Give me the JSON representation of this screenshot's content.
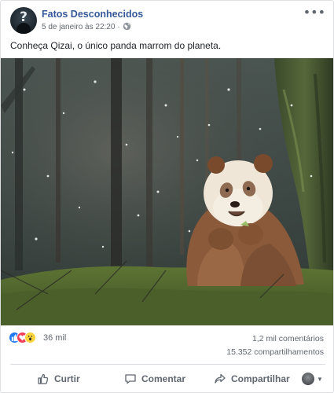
{
  "post": {
    "page_name": "Fatos Desconhecidos",
    "timestamp": "5 de janeiro às 22:20",
    "separator": "·",
    "privacy_icon": "globe-icon",
    "menu_icon": "more-options-icon",
    "avatar_glyph": "?",
    "text": "Conheça Qizai, o único panda marrom do planeta."
  },
  "photo": {
    "subject": "brown-panda",
    "colors": {
      "forest_dark": "#3a4340",
      "fur_brown": "#8a5a3a",
      "fur_cream": "#efe6d8",
      "grass": "#6f8a3a"
    }
  },
  "engagement": {
    "reaction_icons": [
      "like-react-icon",
      "love-react-icon",
      "wow-react-icon"
    ],
    "reaction_count": "36 mil",
    "comments": "1,2 mil comentários",
    "shares": "15.352 compartilhamentos"
  },
  "actions": {
    "like_label": "Curtir",
    "comment_label": "Comentar",
    "share_label": "Compartilhar"
  },
  "colors": {
    "link_blue": "#365899",
    "muted": "#606770",
    "like_blue": "#2078f4",
    "love_red": "#f33e58",
    "wow_yellow": "#fcd33d"
  }
}
